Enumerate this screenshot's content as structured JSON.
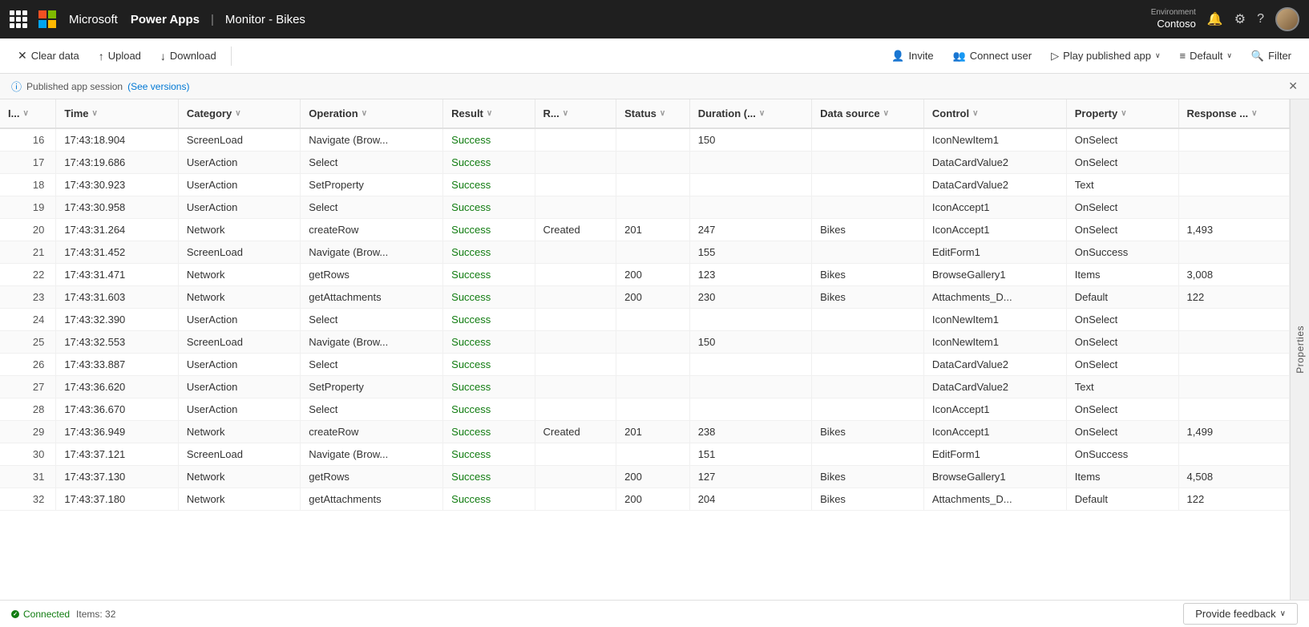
{
  "topbar": {
    "title": "Power Apps",
    "separator": "|",
    "subtitle": "Monitor - Bikes",
    "environment_label": "Environment",
    "environment_name": "Contoso"
  },
  "toolbar": {
    "clear_data": "Clear data",
    "upload": "Upload",
    "download": "Download",
    "invite": "Invite",
    "connect_user": "Connect user",
    "play_published_app": "Play published app",
    "default": "Default",
    "filter": "Filter"
  },
  "infobar": {
    "text": "Published app session",
    "link_text": "(See versions)"
  },
  "table": {
    "columns": [
      "I...",
      "Time",
      "Category",
      "Operation",
      "Result",
      "R...",
      "Status",
      "Duration (...",
      "Data source",
      "Control",
      "Property",
      "Response ..."
    ],
    "rows": [
      {
        "id": "16",
        "time": "17:43:18.904",
        "category": "ScreenLoad",
        "operation": "Navigate (Brow...",
        "result": "Success",
        "r": "",
        "status": "",
        "duration": "150",
        "datasource": "",
        "control": "IconNewItem1",
        "property": "OnSelect",
        "response": ""
      },
      {
        "id": "17",
        "time": "17:43:19.686",
        "category": "UserAction",
        "operation": "Select",
        "result": "Success",
        "r": "",
        "status": "",
        "duration": "",
        "datasource": "",
        "control": "DataCardValue2",
        "property": "OnSelect",
        "response": ""
      },
      {
        "id": "18",
        "time": "17:43:30.923",
        "category": "UserAction",
        "operation": "SetProperty",
        "result": "Success",
        "r": "",
        "status": "",
        "duration": "",
        "datasource": "",
        "control": "DataCardValue2",
        "property": "Text",
        "response": ""
      },
      {
        "id": "19",
        "time": "17:43:30.958",
        "category": "UserAction",
        "operation": "Select",
        "result": "Success",
        "r": "",
        "status": "",
        "duration": "",
        "datasource": "",
        "control": "IconAccept1",
        "property": "OnSelect",
        "response": ""
      },
      {
        "id": "20",
        "time": "17:43:31.264",
        "category": "Network",
        "operation": "createRow",
        "result": "Success",
        "r": "Created",
        "status": "201",
        "duration": "247",
        "datasource": "Bikes",
        "control": "IconAccept1",
        "property": "OnSelect",
        "response": "1,493"
      },
      {
        "id": "21",
        "time": "17:43:31.452",
        "category": "ScreenLoad",
        "operation": "Navigate (Brow...",
        "result": "Success",
        "r": "",
        "status": "",
        "duration": "155",
        "datasource": "",
        "control": "EditForm1",
        "property": "OnSuccess",
        "response": ""
      },
      {
        "id": "22",
        "time": "17:43:31.471",
        "category": "Network",
        "operation": "getRows",
        "result": "Success",
        "r": "",
        "status": "200",
        "duration": "123",
        "datasource": "Bikes",
        "control": "BrowseGallery1",
        "property": "Items",
        "response": "3,008"
      },
      {
        "id": "23",
        "time": "17:43:31.603",
        "category": "Network",
        "operation": "getAttachments",
        "result": "Success",
        "r": "",
        "status": "200",
        "duration": "230",
        "datasource": "Bikes",
        "control": "Attachments_D...",
        "property": "Default",
        "response": "122"
      },
      {
        "id": "24",
        "time": "17:43:32.390",
        "category": "UserAction",
        "operation": "Select",
        "result": "Success",
        "r": "",
        "status": "",
        "duration": "",
        "datasource": "",
        "control": "IconNewItem1",
        "property": "OnSelect",
        "response": ""
      },
      {
        "id": "25",
        "time": "17:43:32.553",
        "category": "ScreenLoad",
        "operation": "Navigate (Brow...",
        "result": "Success",
        "r": "",
        "status": "",
        "duration": "150",
        "datasource": "",
        "control": "IconNewItem1",
        "property": "OnSelect",
        "response": ""
      },
      {
        "id": "26",
        "time": "17:43:33.887",
        "category": "UserAction",
        "operation": "Select",
        "result": "Success",
        "r": "",
        "status": "",
        "duration": "",
        "datasource": "",
        "control": "DataCardValue2",
        "property": "OnSelect",
        "response": ""
      },
      {
        "id": "27",
        "time": "17:43:36.620",
        "category": "UserAction",
        "operation": "SetProperty",
        "result": "Success",
        "r": "",
        "status": "",
        "duration": "",
        "datasource": "",
        "control": "DataCardValue2",
        "property": "Text",
        "response": ""
      },
      {
        "id": "28",
        "time": "17:43:36.670",
        "category": "UserAction",
        "operation": "Select",
        "result": "Success",
        "r": "",
        "status": "",
        "duration": "",
        "datasource": "",
        "control": "IconAccept1",
        "property": "OnSelect",
        "response": ""
      },
      {
        "id": "29",
        "time": "17:43:36.949",
        "category": "Network",
        "operation": "createRow",
        "result": "Success",
        "r": "Created",
        "status": "201",
        "duration": "238",
        "datasource": "Bikes",
        "control": "IconAccept1",
        "property": "OnSelect",
        "response": "1,499"
      },
      {
        "id": "30",
        "time": "17:43:37.121",
        "category": "ScreenLoad",
        "operation": "Navigate (Brow...",
        "result": "Success",
        "r": "",
        "status": "",
        "duration": "151",
        "datasource": "",
        "control": "EditForm1",
        "property": "OnSuccess",
        "response": ""
      },
      {
        "id": "31",
        "time": "17:43:37.130",
        "category": "Network",
        "operation": "getRows",
        "result": "Success",
        "r": "",
        "status": "200",
        "duration": "127",
        "datasource": "Bikes",
        "control": "BrowseGallery1",
        "property": "Items",
        "response": "4,508"
      },
      {
        "id": "32",
        "time": "17:43:37.180",
        "category": "Network",
        "operation": "getAttachments",
        "result": "Success",
        "r": "",
        "status": "200",
        "duration": "204",
        "datasource": "Bikes",
        "control": "Attachments_D...",
        "property": "Default",
        "response": "122"
      }
    ]
  },
  "statusbar": {
    "connected_label": "Connected",
    "items_label": "Items: 32"
  },
  "feedback": {
    "label": "Provide feedback"
  },
  "side_panel": {
    "label": "Properties"
  }
}
